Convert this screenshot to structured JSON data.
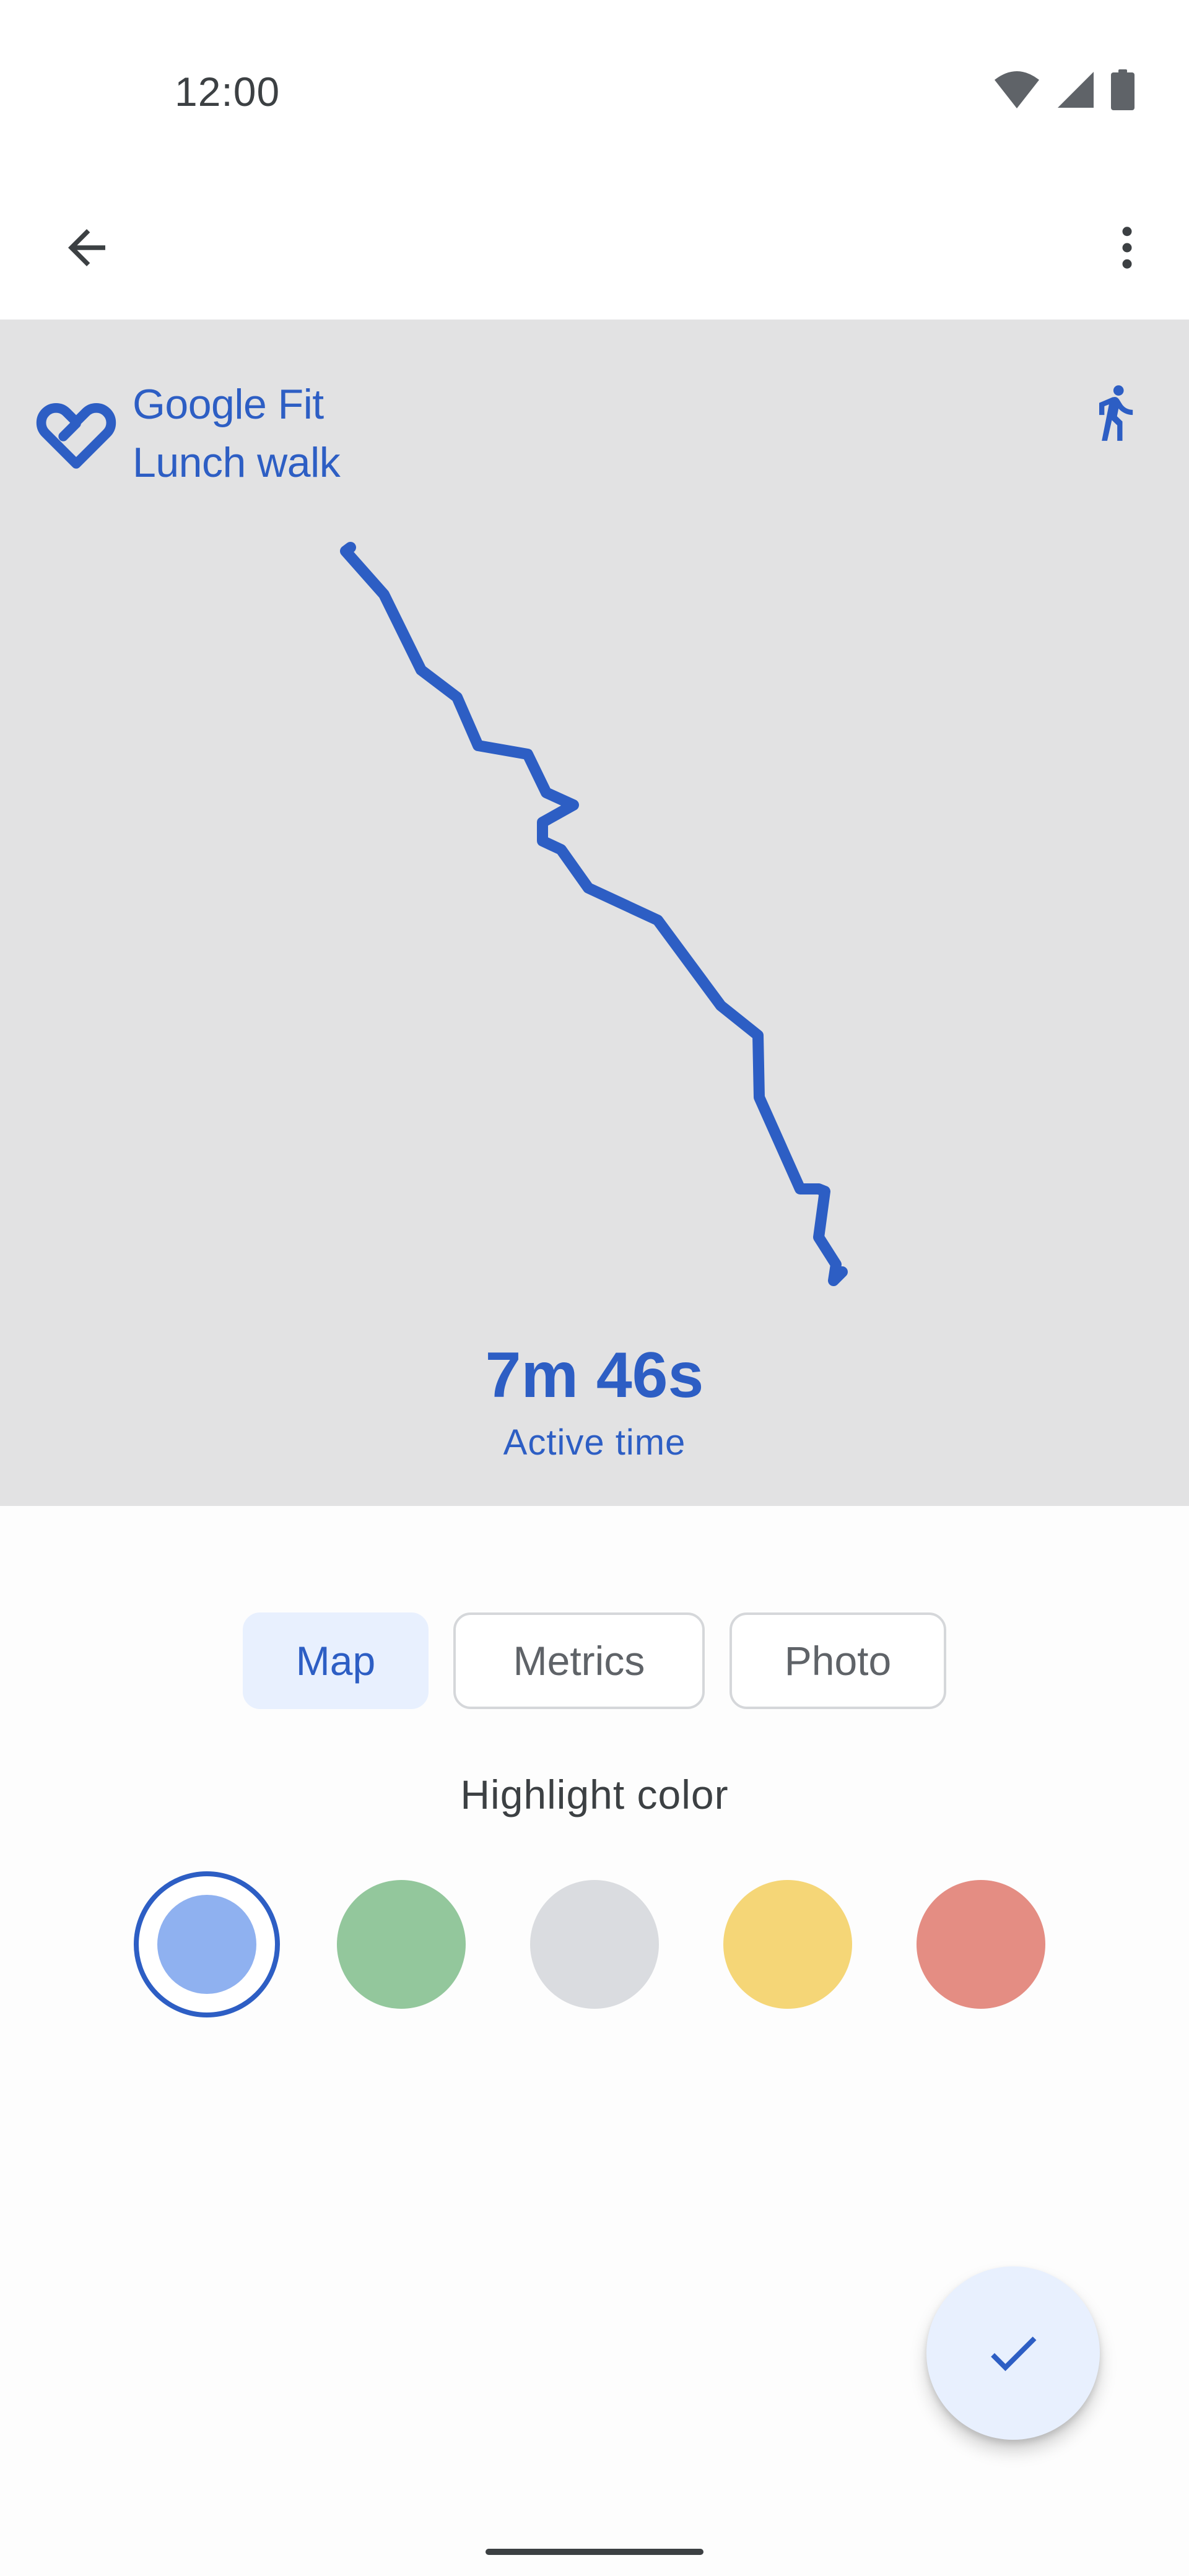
{
  "status_bar": {
    "time": "12:00",
    "icons": [
      "wifi-icon",
      "cell-signal-icon",
      "battery-icon"
    ]
  },
  "app_bar": {
    "icons": [
      "arrow-back-icon",
      "more-vert-icon"
    ]
  },
  "preview": {
    "brand_name": "Google Fit",
    "activity_name": "Lunch walk",
    "activity_icon": "walking-icon",
    "metric_value": "7m 46s",
    "metric_label": "Active time",
    "accent_color": "#2d5ec4",
    "background_color": "#e2e2e3"
  },
  "tabs": [
    {
      "label": "Map",
      "active": true
    },
    {
      "label": "Metrics",
      "active": false
    },
    {
      "label": "Photo",
      "active": false
    }
  ],
  "highlight": {
    "title": "Highlight color",
    "colors": [
      {
        "name": "blue",
        "hex": "#8fb1f0",
        "selected": true
      },
      {
        "name": "green",
        "hex": "#93c79c",
        "selected": false
      },
      {
        "name": "gray",
        "hex": "#dadce0",
        "selected": false
      },
      {
        "name": "yellow",
        "hex": "#f5d677",
        "selected": false
      },
      {
        "name": "red",
        "hex": "#e48d83",
        "selected": false
      }
    ]
  },
  "fab": {
    "icon": "check-icon"
  }
}
